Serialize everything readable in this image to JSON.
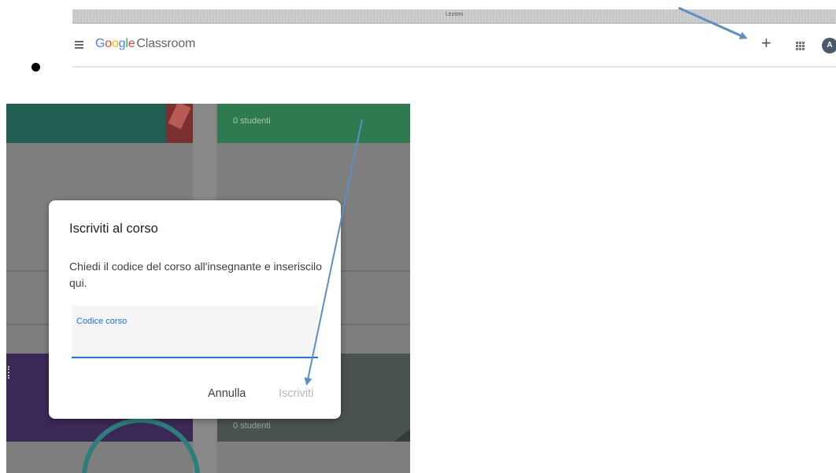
{
  "top_screenshot": {
    "window_title": "Lezioni",
    "app_title": {
      "google_letters": [
        "G",
        "o",
        "o",
        "g",
        "l",
        "e"
      ],
      "product": "Classroom"
    },
    "avatar_initial": "A",
    "icons": {
      "menu": "hamburger-icon",
      "create": "plus-icon",
      "apps": "apps-grid-icon",
      "account": "avatar"
    }
  },
  "dialog": {
    "title": "Iscriviti al corso",
    "instructions": "Chiedi il codice del corso all'insegnante e inseriscilo qui.",
    "code_field": {
      "label": "Codice corso",
      "value": ""
    },
    "cancel_label": "Annulla",
    "join_label": "Iscriviti"
  },
  "background_cards": {
    "card_b_subtitle": "0 studenti",
    "card_d_subtitle": "0 studenti"
  },
  "colors": {
    "annotation_arrow": "#5b8fc7",
    "accent_blue": "#1a73e8",
    "disabled_text": "#b9b9b9"
  }
}
